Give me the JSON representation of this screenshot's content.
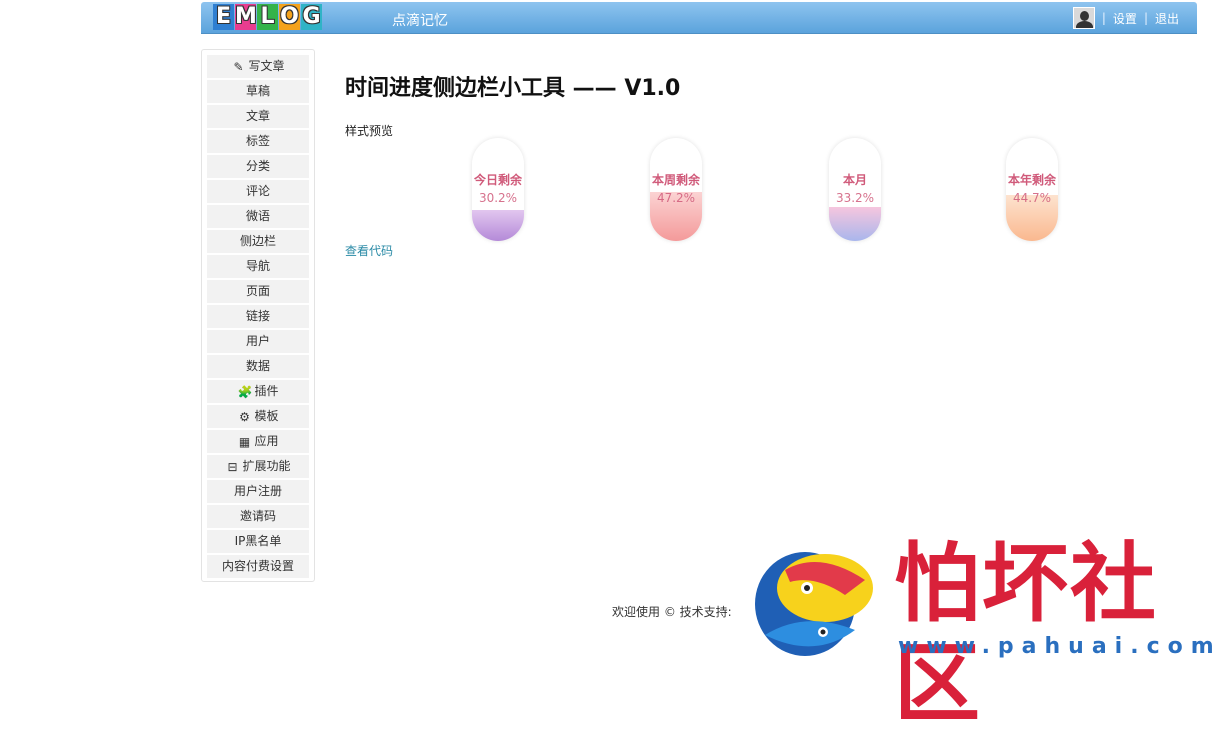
{
  "header": {
    "logo_letters": [
      "E",
      "M",
      "L",
      "O",
      "G"
    ],
    "logo_colors": [
      "#2f7fd1",
      "#e83c8f",
      "#35b34a",
      "#f4a21b",
      "#2fb3c6"
    ],
    "site_name": "点滴记忆",
    "settings_label": "设置",
    "logout_label": "退出",
    "avatar_icon": "user-avatar-icon"
  },
  "sidebar": {
    "items": [
      {
        "label": "写文章",
        "icon": "✎"
      },
      {
        "label": "草稿",
        "icon": ""
      },
      {
        "label": "文章",
        "icon": ""
      },
      {
        "label": "标签",
        "icon": ""
      },
      {
        "label": "分类",
        "icon": ""
      },
      {
        "label": "评论",
        "icon": ""
      },
      {
        "label": "微语",
        "icon": ""
      },
      {
        "label": "侧边栏",
        "icon": ""
      },
      {
        "label": "导航",
        "icon": ""
      },
      {
        "label": "页面",
        "icon": ""
      },
      {
        "label": "链接",
        "icon": ""
      },
      {
        "label": "用户",
        "icon": ""
      },
      {
        "label": "数据",
        "icon": ""
      },
      {
        "label": "插件",
        "icon": "🧩"
      },
      {
        "label": "模板",
        "icon": "⚙"
      },
      {
        "label": "应用",
        "icon": "▦"
      },
      {
        "label": "扩展功能",
        "icon": "⊟"
      },
      {
        "label": "用户注册",
        "icon": ""
      },
      {
        "label": "邀请码",
        "icon": ""
      },
      {
        "label": "IP黑名单",
        "icon": ""
      },
      {
        "label": "内容付费设置",
        "icon": ""
      }
    ]
  },
  "main": {
    "title": "时间进度侧边栏小工具 —— V1.0",
    "preview_label": "样式预览",
    "code_link": "查看代码",
    "pills": [
      {
        "label": "今日剩余",
        "percent_text": "30.2%",
        "percent": 30.2,
        "colors": [
          "#e2c6ef",
          "#b48ad8"
        ]
      },
      {
        "label": "本周剩余",
        "percent_text": "47.2%",
        "percent": 47.2,
        "colors": [
          "#fbd3d3",
          "#f49a9a"
        ]
      },
      {
        "label": "本月",
        "percent_text": "33.2%",
        "percent": 33.2,
        "colors": [
          "#f6c6de",
          "#a9b6ec"
        ]
      },
      {
        "label": "本年剩余",
        "percent_text": "44.7%",
        "percent": 44.7,
        "colors": [
          "#fde3cf",
          "#fab88f"
        ]
      }
    ]
  },
  "footer": {
    "text": "欢迎使用 © 技术支持:"
  },
  "watermark": {
    "cn_text": "怕坏社区",
    "url": "www.pahuai.com"
  }
}
